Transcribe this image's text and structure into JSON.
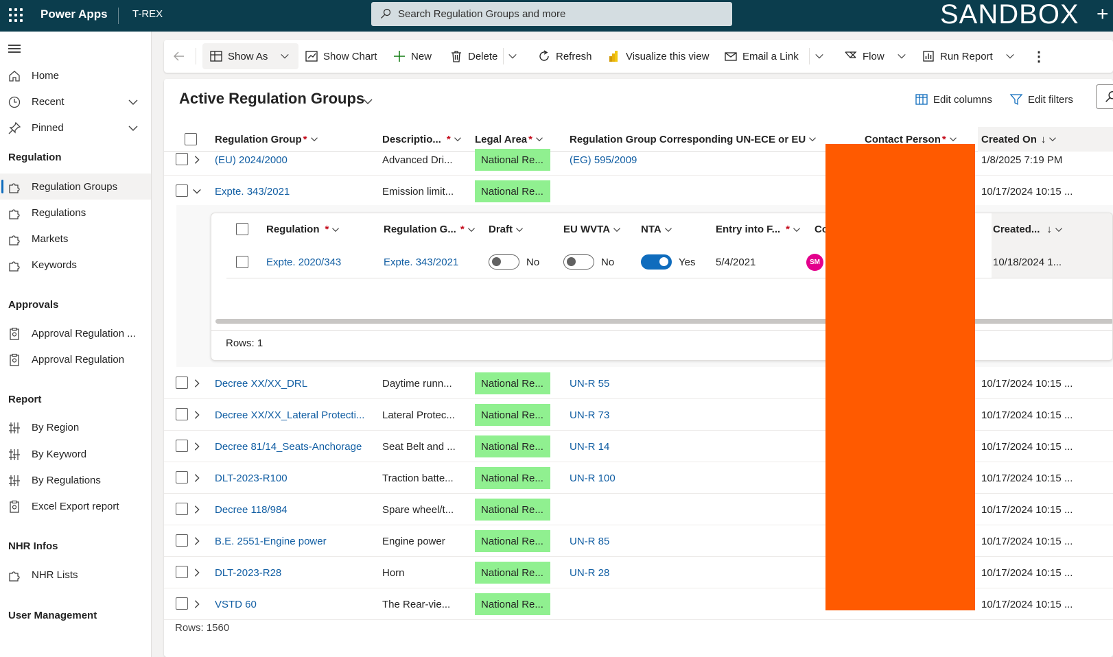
{
  "topbar": {
    "app_name": "Power Apps",
    "environment": "T-REX",
    "search_placeholder": "Search Regulation Groups and more",
    "badge": "SANDBOX",
    "plus": "+"
  },
  "sidebar": {
    "items": [
      {
        "label": "Home",
        "icon": "home-icon"
      },
      {
        "label": "Recent",
        "icon": "clock-icon"
      },
      {
        "label": "Pinned",
        "icon": "pin-icon"
      }
    ],
    "groups": [
      {
        "title": "Regulation",
        "items": [
          "Regulation Groups",
          "Regulations",
          "Markets",
          "Keywords"
        ]
      },
      {
        "title": "Approvals",
        "items": [
          "Approval Regulation ...",
          "Approval Regulation"
        ]
      },
      {
        "title": "Report",
        "items": [
          "By Region",
          "By Keyword",
          "By Regulations",
          "Excel Export report"
        ]
      },
      {
        "title": "NHR Infos",
        "items": [
          "NHR Lists"
        ]
      },
      {
        "title": "User Management",
        "items": []
      }
    ],
    "selected": "Regulation Groups"
  },
  "commandbar": {
    "show_as": "Show As",
    "show_chart": "Show Chart",
    "new": "New",
    "delete": "Delete",
    "refresh": "Refresh",
    "visualize": "Visualize this view",
    "email_link": "Email a Link",
    "flow": "Flow",
    "run_report": "Run Report",
    "more": "⋮"
  },
  "view": {
    "title": "Active Regulation Groups",
    "edit_columns": "Edit columns",
    "edit_filters": "Edit filters",
    "columns": [
      {
        "label": "Regulation Group",
        "required": true
      },
      {
        "label": "Descriptio...",
        "required": true
      },
      {
        "label": "Legal Area",
        "required": true
      },
      {
        "label": "Regulation Group Corresponding UN-ECE or EU",
        "required": false
      },
      {
        "label": "Contact Person",
        "required": true
      },
      {
        "label": "Created On",
        "sort": "↓"
      }
    ],
    "rows": [
      {
        "group": "(EU) 2024/2000",
        "desc": "Advanced Dri...",
        "area": "National Re...",
        "corr": "(EG) 595/2009",
        "created": "1/8/2025 7:19 PM",
        "expanded": false
      },
      {
        "group": "Expte. 343/2021",
        "desc": "Emission limit...",
        "area": "National Re...",
        "corr": "",
        "created": "10/17/2024 10:15 ...",
        "expanded": true
      },
      {
        "group": "Decree XX/XX_DRL",
        "desc": "Daytime runn...",
        "area": "National Re...",
        "corr": "UN-R 55",
        "created": "10/17/2024 10:15 ...",
        "expanded": false
      },
      {
        "group": "Decree XX/XX_Lateral Protecti...",
        "desc": "Lateral Protec...",
        "area": "National Re...",
        "corr": "UN-R 73",
        "created": "10/17/2024 10:15 ...",
        "expanded": false
      },
      {
        "group": "Decree 81/14_Seats-Anchorage",
        "desc": "Seat Belt and ...",
        "area": "National Re...",
        "corr": "UN-R 14",
        "created": "10/17/2024 10:15 ...",
        "expanded": false
      },
      {
        "group": "DLT-2023-R100",
        "desc": "Traction batte...",
        "area": "National Re...",
        "corr": "UN-R 100",
        "created": "10/17/2024 10:15 ...",
        "expanded": false
      },
      {
        "group": "Decree 118/984",
        "desc": "Spare wheel/t...",
        "area": "National Re...",
        "corr": "",
        "created": "10/17/2024 10:15 ...",
        "expanded": false
      },
      {
        "group": "B.E. 2551-Engine power",
        "desc": "Engine power",
        "area": "National Re...",
        "corr": "UN-R 85",
        "created": "10/17/2024 10:15 ...",
        "expanded": false
      },
      {
        "group": "DLT-2023-R28",
        "desc": "Horn",
        "area": "National Re...",
        "corr": "UN-R 28",
        "created": "10/17/2024 10:15 ...",
        "expanded": false
      },
      {
        "group": "VSTD 60",
        "desc": "The Rear-vie...",
        "area": "National Re...",
        "corr": "",
        "created": "10/17/2024 10:15 ...",
        "expanded": false
      }
    ],
    "rows_total": "Rows: 1560"
  },
  "subgrid": {
    "columns": [
      {
        "label": "Regulation",
        "required": true
      },
      {
        "label": "Regulation G...",
        "required": true
      },
      {
        "label": "Draft",
        "required": false
      },
      {
        "label": "EU WVTA",
        "required": false
      },
      {
        "label": "NTA",
        "required": false
      },
      {
        "label": "Entry into F...",
        "required": true
      },
      {
        "label": "Cor",
        "required": false
      },
      {
        "label": "Created...",
        "sort": "↓"
      }
    ],
    "row": {
      "regulation": "Expte. 2020/343",
      "group": "Expte. 343/2021",
      "draft": "No",
      "eu_wvta": "No",
      "nta": "Yes",
      "entry": "5/4/2021",
      "avatar": "SM",
      "avatar_tail": "S",
      "created": "10/18/2024 1..."
    },
    "rows_count": "Rows: 1"
  },
  "colors": {
    "topbar": "#0b3d4d",
    "tag": "#90f090",
    "link": "#115ea3",
    "redaction": "#ff5a00",
    "toggle_on": "#0f6cbd"
  }
}
